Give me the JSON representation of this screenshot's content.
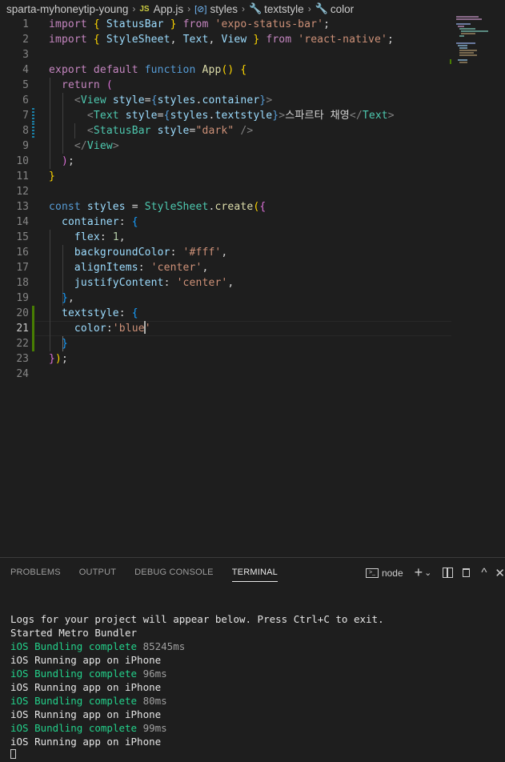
{
  "breadcrumb": {
    "folder": "sparta-myhoneytip-young",
    "file_badge": "JS",
    "file": "App.js",
    "symbol1": "styles",
    "symbol2": "textstyle",
    "symbol3": "color"
  },
  "editor": {
    "line_numbers": [
      "1",
      "2",
      "3",
      "4",
      "5",
      "6",
      "7",
      "8",
      "9",
      "10",
      "11",
      "12",
      "13",
      "14",
      "15",
      "16",
      "17",
      "18",
      "19",
      "20",
      "21",
      "22",
      "23",
      "24"
    ],
    "l1": {
      "import": "import",
      "open": "{ ",
      "name": "StatusBar",
      "close": " }",
      "from": "from",
      "src": "'expo-status-bar'",
      "semi": ";"
    },
    "l2": {
      "import": "import",
      "open": "{ ",
      "n1": "StyleSheet",
      "c1": ", ",
      "n2": "Text",
      "c2": ", ",
      "n3": "View",
      "close": " }",
      "from": "from",
      "src": "'react-native'",
      "semi": ";"
    },
    "l4": {
      "export": "export",
      "default": "default",
      "function": "function",
      "name": "App",
      "parens": "()",
      "brace": "{"
    },
    "l5": {
      "return": "return",
      "paren": "("
    },
    "l6": {
      "lt": "<",
      "tag": "View",
      "attr": "style",
      "eq": "=",
      "ob": "{",
      "obj": "styles",
      "dot": ".",
      "prop": "container",
      "cb": "}",
      "gt": ">"
    },
    "l7": {
      "lt": "<",
      "tag": "Text",
      "attr": "style",
      "eq": "=",
      "ob": "{",
      "obj": "styles",
      "dot": ".",
      "prop": "textstyle",
      "cb": "}",
      "gt": ">",
      "text": "스파르타 채영",
      "close_lt": "</",
      "close_tag": "Text",
      "close_gt": ">"
    },
    "l8": {
      "lt": "<",
      "tag": "StatusBar",
      "attr": "style",
      "eq": "=",
      "val": "\"dark\"",
      "end": " />"
    },
    "l9": {
      "lt": "</",
      "tag": "View",
      "gt": ">"
    },
    "l10": {
      "paren": ")",
      "semi": ";"
    },
    "l11": {
      "brace": "}"
    },
    "l13": {
      "const": "const",
      "name": "styles",
      "eq": " = ",
      "cls": "StyleSheet",
      "dot": ".",
      "fn": "create",
      "p": "(",
      "b": "{"
    },
    "l14": {
      "key": "container",
      "colon": ": ",
      "b": "{"
    },
    "l15": {
      "key": "flex",
      "colon": ": ",
      "val": "1",
      "comma": ","
    },
    "l16": {
      "key": "backgroundColor",
      "colon": ": ",
      "val": "'#fff'",
      "comma": ","
    },
    "l17": {
      "key": "alignItems",
      "colon": ": ",
      "val": "'center'",
      "comma": ","
    },
    "l18": {
      "key": "justifyContent",
      "colon": ": ",
      "val": "'center'",
      "comma": ","
    },
    "l19": {
      "b": "}",
      "comma": ","
    },
    "l20": {
      "key": "textstyle",
      "colon": ": ",
      "b": "{"
    },
    "l21": {
      "key": "color",
      "colon": ":",
      "val_a": "'blue",
      "val_b": "'"
    },
    "l22": {
      "b": "}"
    },
    "l23": {
      "b": "}",
      "p": ")",
      "semi": ";"
    }
  },
  "panel": {
    "tabs": [
      "PROBLEMS",
      "OUTPUT",
      "DEBUG CONSOLE",
      "TERMINAL"
    ],
    "terminal_name": "node",
    "plus": "+",
    "chev": "⌄",
    "split": "▯",
    "trash": "🗑",
    "up": "^",
    "close": "✕"
  },
  "terminal": {
    "line1": "Logs for your project will appear below. Press Ctrl+C to exit.",
    "line2": "Started Metro Bundler",
    "ios": "iOS",
    "bundling": "Bundling complete",
    "running": "Running app on iPhone",
    "times": [
      "85245ms",
      "96ms",
      "80ms",
      "99ms"
    ]
  },
  "colors": {
    "background": "#1e1e1e",
    "terminal_green": "#23d18b",
    "gutter_modified": "#487e02"
  }
}
